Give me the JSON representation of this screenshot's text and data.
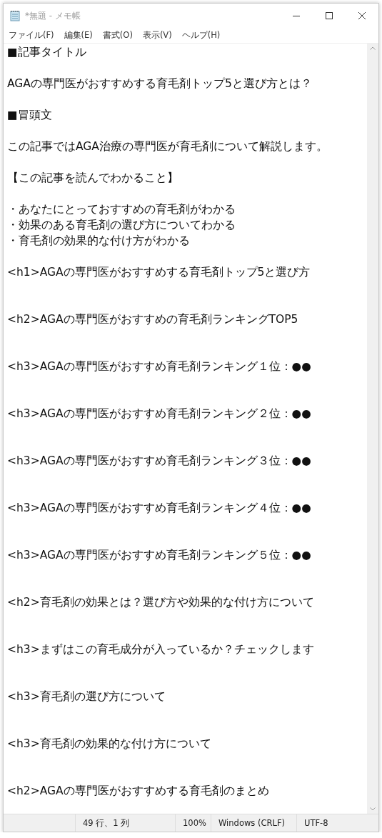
{
  "window": {
    "title": "*無題 - メモ帳"
  },
  "menu": [
    "ファイル(F)",
    "編集(E)",
    "書式(O)",
    "表示(V)",
    "ヘルプ(H)"
  ],
  "editor": {
    "lines": [
      {
        "kind": "text",
        "text": "■記事タイトル"
      },
      {
        "kind": "blank"
      },
      {
        "kind": "text",
        "text": "AGAの専門医がおすすめする育毛剤トップ5と選び方とは？"
      },
      {
        "kind": "blank"
      },
      {
        "kind": "text",
        "text": "■冒頭文"
      },
      {
        "kind": "blank"
      },
      {
        "kind": "text",
        "text": "この記事ではAGA治療の専門医が育毛剤について解説します。"
      },
      {
        "kind": "blank"
      },
      {
        "kind": "text",
        "text": "【この記事を読んでわかること】"
      },
      {
        "kind": "blank"
      },
      {
        "kind": "text",
        "text": "・あなたにとっておすすめの育毛剤がわかる"
      },
      {
        "kind": "text",
        "text": "・効果のある育毛剤の選び方についてわかる"
      },
      {
        "kind": "text",
        "text": "・育毛剤の効果的な付け方がわかる"
      },
      {
        "kind": "blank"
      },
      {
        "kind": "text",
        "text": "<h1>AGAの専門医がおすすめする育毛剤トップ5と選び方"
      },
      {
        "kind": "blank"
      },
      {
        "kind": "blank"
      },
      {
        "kind": "text",
        "text": "<h2>AGAの専門医がおすすめの育毛剤ランキングTOP5"
      },
      {
        "kind": "blank"
      },
      {
        "kind": "blank"
      },
      {
        "kind": "text",
        "text": "<h3>AGAの専門医がおすすめ育毛剤ランキング１位：●●"
      },
      {
        "kind": "blank"
      },
      {
        "kind": "blank"
      },
      {
        "kind": "text",
        "text": "<h3>AGAの専門医がおすすめ育毛剤ランキング２位：●●"
      },
      {
        "kind": "blank"
      },
      {
        "kind": "blank"
      },
      {
        "kind": "text",
        "text": "<h3>AGAの専門医がおすすめ育毛剤ランキング３位：●●"
      },
      {
        "kind": "blank"
      },
      {
        "kind": "blank"
      },
      {
        "kind": "text",
        "text": "<h3>AGAの専門医がおすすめ育毛剤ランキング４位：●●"
      },
      {
        "kind": "blank"
      },
      {
        "kind": "blank"
      },
      {
        "kind": "text",
        "text": "<h3>AGAの専門医がおすすめ育毛剤ランキング５位：●●"
      },
      {
        "kind": "blank"
      },
      {
        "kind": "blank"
      },
      {
        "kind": "text",
        "text": "<h2>育毛剤の効果とは？選び方や効果的な付け方について"
      },
      {
        "kind": "blank"
      },
      {
        "kind": "blank"
      },
      {
        "kind": "text",
        "text": "<h3>まずはこの育毛成分が入っているか？チェックします"
      },
      {
        "kind": "blank"
      },
      {
        "kind": "blank"
      },
      {
        "kind": "text",
        "text": "<h3>育毛剤の選び方について"
      },
      {
        "kind": "blank"
      },
      {
        "kind": "blank"
      },
      {
        "kind": "text",
        "text": "<h3>育毛剤の効果的な付け方について"
      },
      {
        "kind": "blank"
      },
      {
        "kind": "blank"
      },
      {
        "kind": "text",
        "text": "<h2>AGAの専門医がおすすめする育毛剤のまとめ"
      }
    ]
  },
  "status_bar": {
    "position": "49 行、1 列",
    "zoom": "100%",
    "line_ending": "Windows (CRLF)",
    "encoding": "UTF-8"
  }
}
